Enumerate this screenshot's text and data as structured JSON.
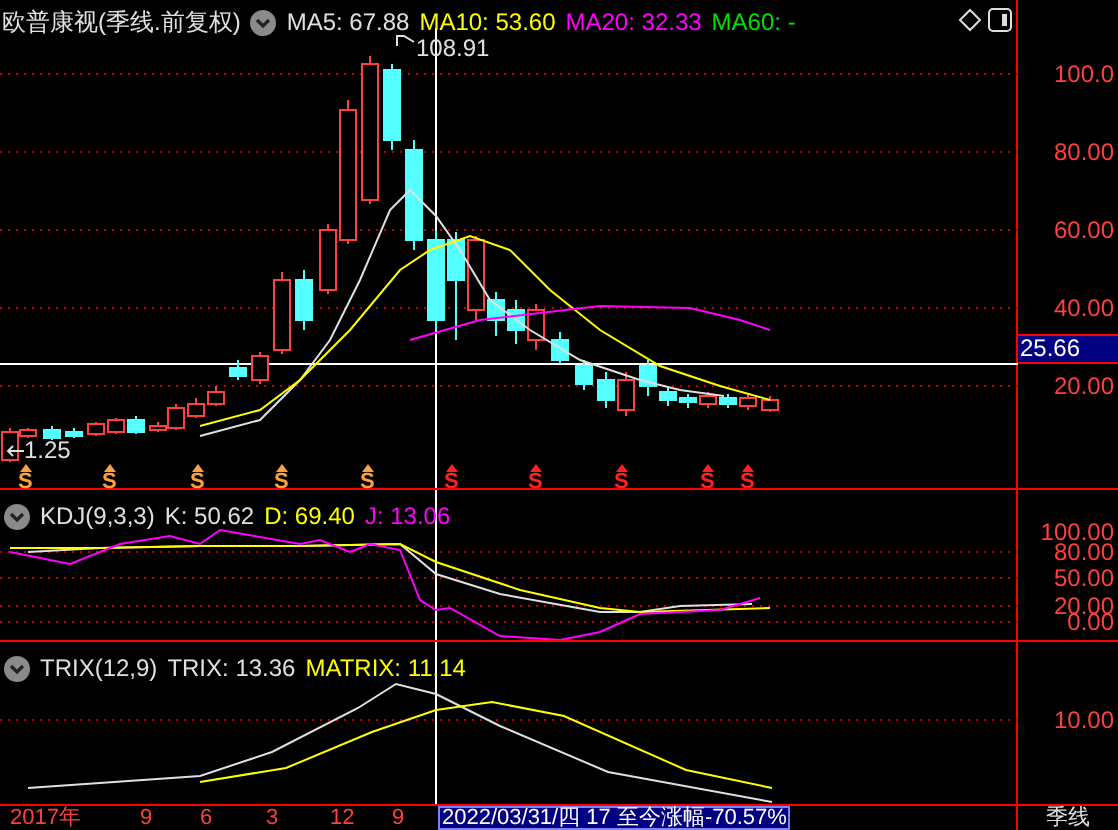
{
  "header": {
    "title": "欧普康视(季线.前复权)",
    "indicators": [
      {
        "label": "MA5: 67.88",
        "color": "#e0e0e0"
      },
      {
        "label": "MA10: 53.60",
        "color": "#ffff00"
      },
      {
        "label": "MA20: 32.33",
        "color": "#ff00ff"
      },
      {
        "label": "MA60: -",
        "color": "#00e000"
      }
    ]
  },
  "price_axis": {
    "labels": [
      "100.0",
      "80.00",
      "60.00",
      "40.00",
      "20.00"
    ],
    "current": "25.66"
  },
  "price_marks": {
    "high": "108.91",
    "low": "1.25"
  },
  "signals": [
    {
      "label": "S",
      "color": "#ffa040"
    },
    {
      "label": "S",
      "color": "#ffa040"
    },
    {
      "label": "S",
      "color": "#ffa040"
    },
    {
      "label": "S",
      "color": "#ffa040"
    },
    {
      "label": "S",
      "color": "#ffa040"
    },
    {
      "label": "S",
      "color": "#ff2020"
    },
    {
      "label": "S",
      "color": "#ff2020"
    },
    {
      "label": "S",
      "color": "#ff2020"
    },
    {
      "label": "S",
      "color": "#ff2020"
    },
    {
      "label": "S",
      "color": "#ff2020"
    }
  ],
  "kdj": {
    "title": "KDJ(9,3,3)",
    "values": [
      {
        "label": "K: 50.62",
        "color": "#e0e0e0"
      },
      {
        "label": "D: 69.40",
        "color": "#ffff00"
      },
      {
        "label": "J: 13.06",
        "color": "#ff00ff"
      }
    ],
    "axis": [
      "100.00",
      "80.00",
      "50.00",
      "20.00",
      "0.00"
    ]
  },
  "trix": {
    "title": "TRIX(12,9)",
    "values": [
      {
        "label": "TRIX: 13.36",
        "color": "#e0e0e0"
      },
      {
        "label": "MATRIX: 11.14",
        "color": "#ffff00"
      }
    ],
    "axis": [
      "10.00"
    ]
  },
  "time_axis": {
    "labels": [
      "2017年",
      "9",
      "6",
      "3",
      "12",
      "9"
    ],
    "info": "2022/03/31/四 17 至今涨幅-70.57%",
    "period": "季线"
  }
}
